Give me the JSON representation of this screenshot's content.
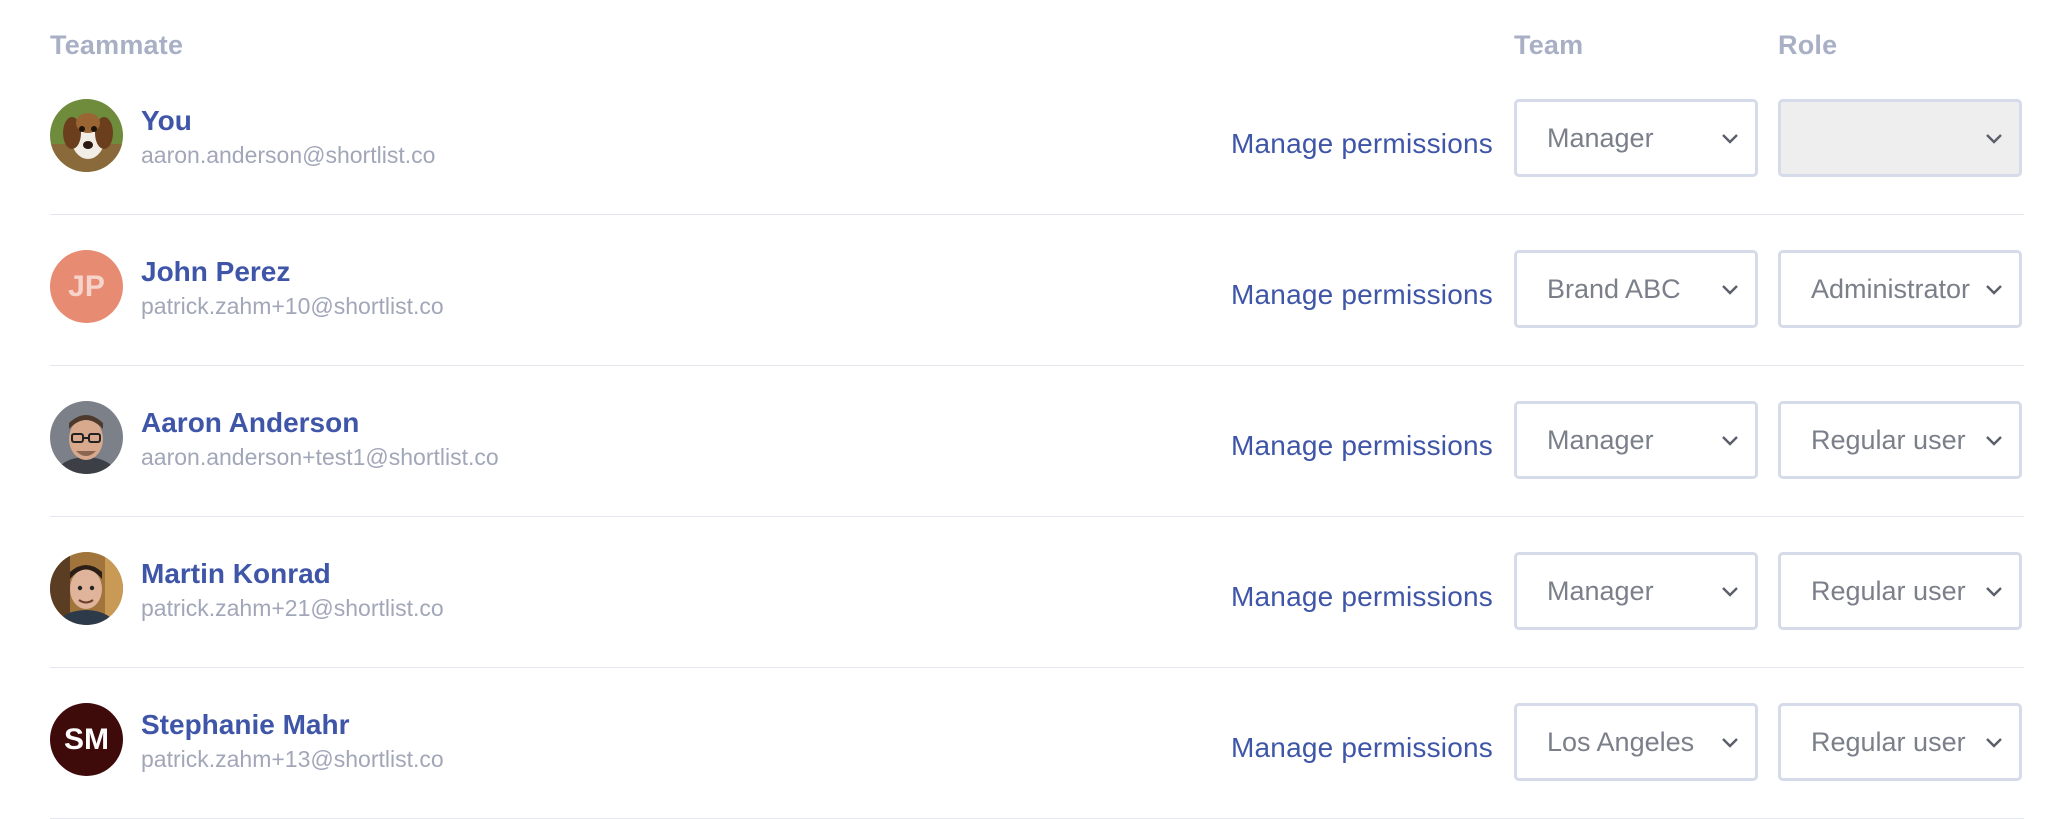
{
  "header": {
    "teammate": "Teammate",
    "team": "Team",
    "role": "Role"
  },
  "rows": [
    {
      "name": "You",
      "email": "aaron.anderson@shortlist.co",
      "avatar": {
        "type": "photo",
        "icon": "dog-photo"
      },
      "manage": "Manage permissions",
      "team": "Manager",
      "role": "",
      "role_disabled": true
    },
    {
      "name": "John Perez",
      "email": "patrick.zahm+10@shortlist.co",
      "avatar": {
        "type": "initials",
        "initials": "JP",
        "bg": "#e88b73",
        "fg": "#f6d4cb"
      },
      "manage": "Manage permissions",
      "team": "Brand ABC",
      "role": "Administrator"
    },
    {
      "name": "Aaron Anderson",
      "email": "aaron.anderson+test1@shortlist.co",
      "avatar": {
        "type": "photo",
        "icon": "man-glasses-photo"
      },
      "manage": "Manage permissions",
      "team": "Manager",
      "role": "Regular user"
    },
    {
      "name": "Martin Konrad",
      "email": "patrick.zahm+21@shortlist.co",
      "avatar": {
        "type": "photo",
        "icon": "man-photo"
      },
      "manage": "Manage permissions",
      "team": "Manager",
      "role": "Regular user"
    },
    {
      "name": "Stephanie Mahr",
      "email": "patrick.zahm+13@shortlist.co",
      "avatar": {
        "type": "initials",
        "initials": "SM",
        "bg": "#3f0a0a",
        "fg": "#ffffff"
      },
      "manage": "Manage permissions",
      "team": "Los Angeles",
      "role": "Regular user"
    }
  ],
  "colors": {
    "accent": "#3e55a8",
    "muted": "#a9b0c5",
    "border": "#d6dbe9"
  }
}
